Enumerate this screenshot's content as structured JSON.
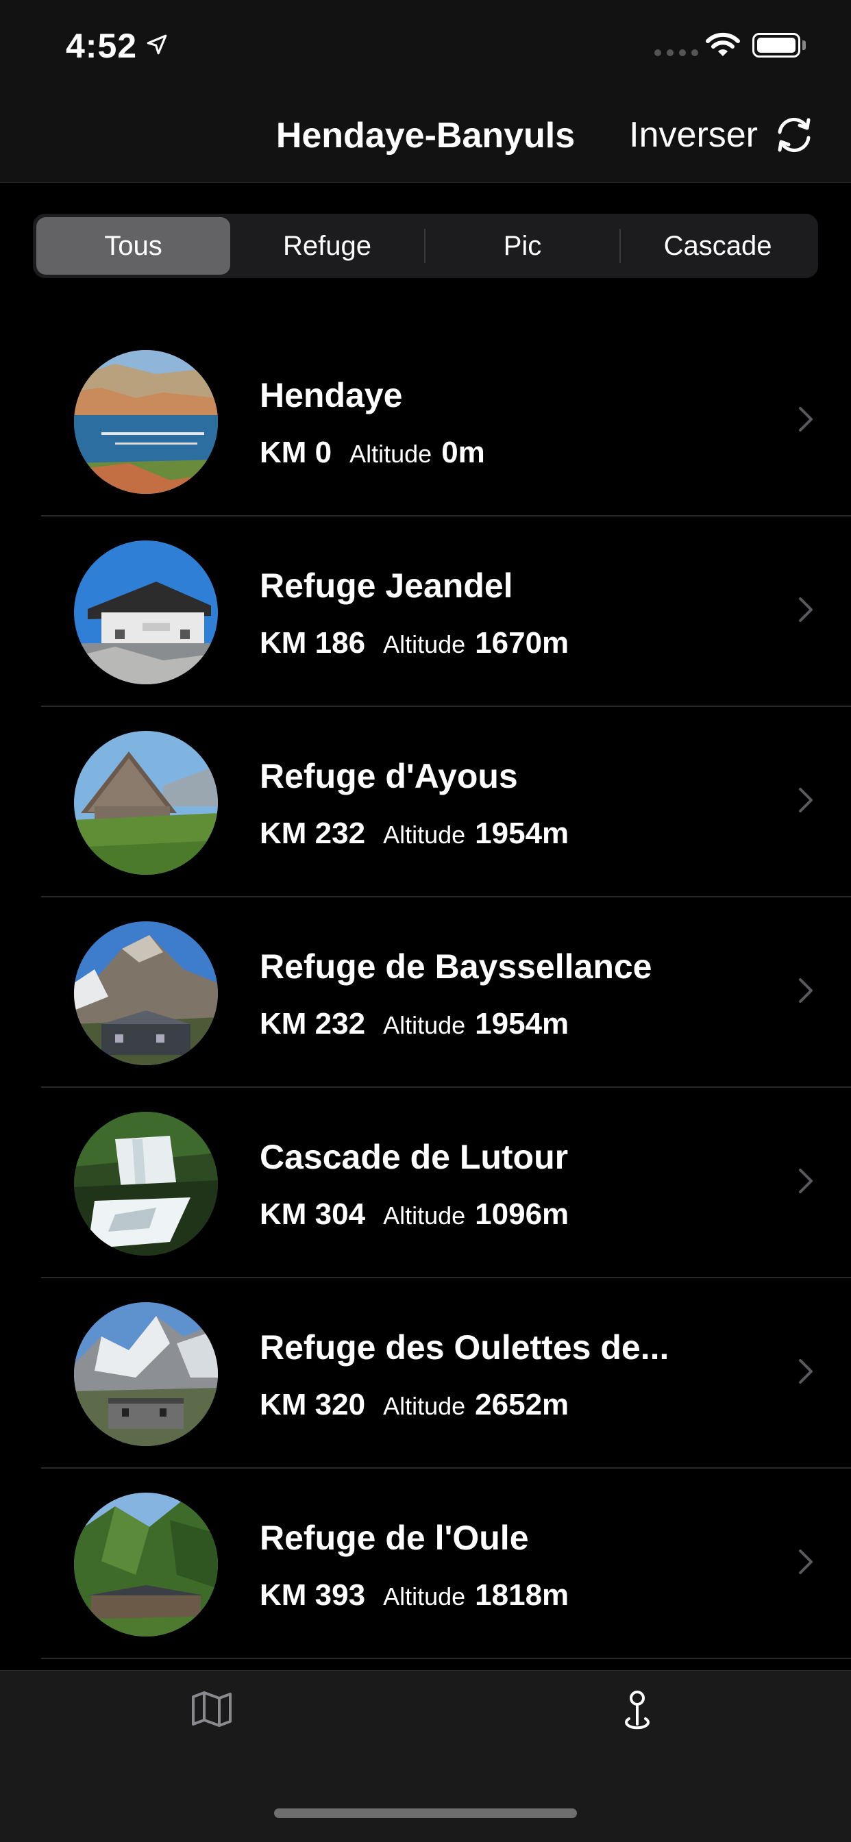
{
  "status_bar": {
    "time": "4:52"
  },
  "nav": {
    "title": "Hendaye-Banyuls",
    "action_label": "Inverser"
  },
  "segments": [
    {
      "label": "Tous",
      "selected": true
    },
    {
      "label": "Refuge",
      "selected": false
    },
    {
      "label": "Pic",
      "selected": false
    },
    {
      "label": "Cascade",
      "selected": false
    }
  ],
  "list": {
    "altitude_label": "Altitude",
    "items": [
      {
        "name": "Hendaye",
        "km": "KM 0",
        "altitude": "0m",
        "image": "coastal-town-harbor"
      },
      {
        "name": "Refuge Jeandel",
        "km": "KM 186",
        "altitude": "1670m",
        "image": "mountain-hut-blue-sky"
      },
      {
        "name": "Refuge d'Ayous",
        "km": "KM 232",
        "altitude": "1954m",
        "image": "stone-hut-meadow"
      },
      {
        "name": "Refuge de Bayssellance",
        "km": "KM 232",
        "altitude": "1954m",
        "image": "hut-below-peak"
      },
      {
        "name": "Cascade de Lutour",
        "km": "KM 304",
        "altitude": "1096m",
        "image": "waterfall-forest"
      },
      {
        "name": "Refuge des Oulettes de...",
        "km": "KM 320",
        "altitude": "2652m",
        "image": "hut-snowy-peaks"
      },
      {
        "name": "Refuge de l'Oule",
        "km": "KM 393",
        "altitude": "1818m",
        "image": "hut-green-mountains"
      }
    ]
  },
  "tabbar": {
    "tabs": [
      {
        "icon": "map-icon",
        "selected": false
      },
      {
        "icon": "pin-location-icon",
        "selected": true
      }
    ]
  },
  "colors": {
    "background": "#000000",
    "bar": "#121212",
    "segment_active": "#636366",
    "chevron": "#5a5a5e"
  }
}
